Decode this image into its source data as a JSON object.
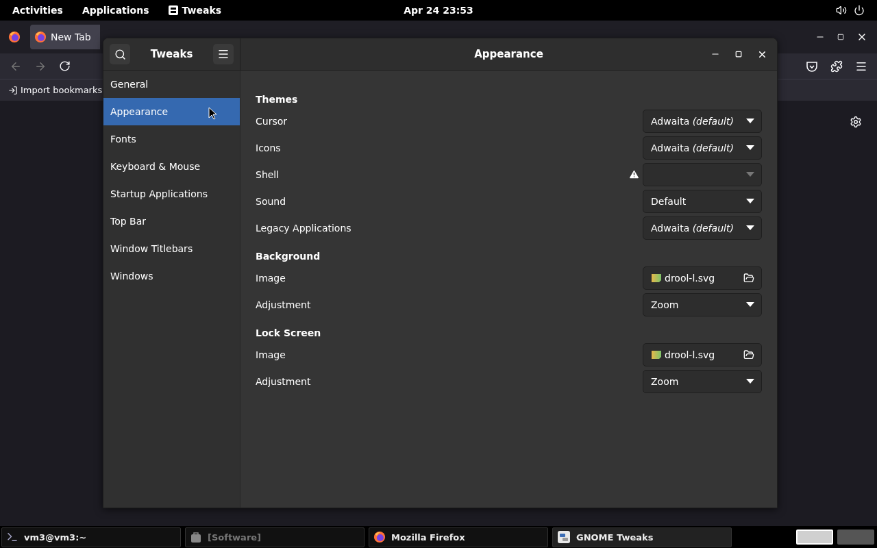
{
  "top_bar": {
    "activities": "Activities",
    "applications": "Applications",
    "app_menu": "Tweaks",
    "clock": "Apr 24  23:53"
  },
  "browser": {
    "tab": {
      "label": "New Tab",
      "selected": true
    },
    "bookmark": "Import bookmarks"
  },
  "tweaks": {
    "title": "Tweaks",
    "page_title": "Appearance",
    "sidebar": [
      {
        "label": "General",
        "selected": false
      },
      {
        "label": "Appearance",
        "selected": true
      },
      {
        "label": "Fonts",
        "selected": false
      },
      {
        "label": "Keyboard & Mouse",
        "selected": false
      },
      {
        "label": "Startup Applications",
        "selected": false
      },
      {
        "label": "Top Bar",
        "selected": false
      },
      {
        "label": "Window Titlebars",
        "selected": false
      },
      {
        "label": "Windows",
        "selected": false
      }
    ],
    "sections": [
      {
        "heading": "Themes",
        "rows": [
          {
            "kind": "dropdown",
            "label": "Cursor",
            "value": "Adwaita *(default)*",
            "disabled": false,
            "warning": false
          },
          {
            "kind": "dropdown",
            "label": "Icons",
            "value": "Adwaita *(default)*",
            "disabled": false,
            "warning": false
          },
          {
            "kind": "dropdown",
            "label": "Shell",
            "disabled": true,
            "warning": true
          },
          {
            "kind": "dropdown",
            "label": "Sound",
            "value": "Default",
            "disabled": false,
            "warning": false
          },
          {
            "kind": "dropdown",
            "label": "Legacy Applications",
            "value": "Adwaita *(default)*",
            "disabled": false,
            "warning": false
          }
        ]
      },
      {
        "heading": "Background",
        "rows": [
          {
            "kind": "file",
            "label": "Image",
            "value": "drool-l.svg"
          },
          {
            "kind": "dropdown",
            "label": "Adjustment",
            "value": "Zoom",
            "disabled": false,
            "warning": false
          }
        ]
      },
      {
        "heading": "Lock Screen",
        "rows": [
          {
            "kind": "file",
            "label": "Image",
            "value": "drool-l.svg"
          },
          {
            "kind": "dropdown",
            "label": "Adjustment",
            "value": "Zoom",
            "disabled": false,
            "warning": false
          }
        ]
      }
    ]
  },
  "taskbar": {
    "windows": [
      {
        "label": "vm3@vm3:~",
        "kind": "terminal",
        "disabled": false,
        "selected": false
      },
      {
        "label": "[Software]",
        "kind": "software",
        "disabled": true,
        "selected": false
      },
      {
        "label": "Mozilla Firefox",
        "kind": "firefox",
        "disabled": false,
        "selected": false
      },
      {
        "label": "GNOME Tweaks",
        "kind": "tweaks",
        "disabled": false,
        "selected": true
      }
    ],
    "workspaces": [
      {
        "selected": true
      },
      {
        "selected": false
      }
    ]
  }
}
